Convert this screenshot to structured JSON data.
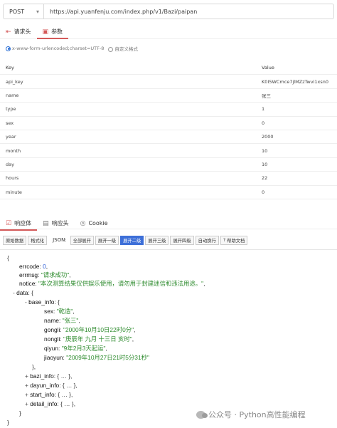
{
  "request": {
    "method": "POST",
    "url": "https://api.yuanfenju.com/index.php/v1/Bazi/paipan"
  },
  "top_tabs": [
    {
      "label": "请求头",
      "icon": "headers-icon"
    },
    {
      "label": "参数",
      "icon": "params-icon"
    }
  ],
  "body_type": {
    "option1": "x-www-form-urlencoded;charset=UTF-8",
    "option2": "自定义格式"
  },
  "params": {
    "key_header": "Key",
    "value_header": "Value",
    "rows": [
      {
        "key": "api_key",
        "value": "K0I5WCmce7jlMZzTwvi1xsn0"
      },
      {
        "key": "name",
        "value": "张三"
      },
      {
        "key": "type",
        "value": "1"
      },
      {
        "key": "sex",
        "value": "0"
      },
      {
        "key": "year",
        "value": "2000"
      },
      {
        "key": "month",
        "value": "10"
      },
      {
        "key": "day",
        "value": "10"
      },
      {
        "key": "hours",
        "value": "22"
      },
      {
        "key": "minute",
        "value": "0"
      }
    ]
  },
  "response_tabs": [
    {
      "label": "响应体",
      "icon": "response-body-icon"
    },
    {
      "label": "响应头",
      "icon": "response-headers-icon"
    },
    {
      "label": "Cookie",
      "icon": "cookie-icon"
    }
  ],
  "toolbar": {
    "raw": "原始数据",
    "format": "格式化",
    "json_label": "JSON:",
    "expand_all": "全部展开",
    "expand_1": "展开一级",
    "expand_2": "展开二级",
    "expand_3": "展开三级",
    "expand_4": "展开四级",
    "auto_wrap": "自动换行",
    "help": "帮助文档"
  },
  "json": {
    "open_brace": "{",
    "errcode_key": "errcode",
    "errcode_val": "0",
    "errmsg_key": "errmsg",
    "errmsg_val": "\"请求成功\"",
    "notice_key": "notice",
    "notice_val": "\"本次测算结果仅供娱乐使用，请勿用于封建迷信和违法用途。\"",
    "data_key": "data",
    "base_info_key": "base_info",
    "sex_key": "sex",
    "sex_val": "\"乾造\"",
    "name_key": "name",
    "name_val": "\"张三\"",
    "gongli_key": "gongli",
    "gongli_val": "\"2000年10月10日22时0分\"",
    "nongli_key": "nongli",
    "nongli_val": "\"庚辰年 九月 十三日 亥时\"",
    "qiyun_key": "qiyun",
    "qiyun_val": "\"9年2月3天起运\"",
    "jiaoyun_key": "jiaoyun",
    "jiaoyun_val": "\"2009年10月27日21时5分31秒\"",
    "bazi_info_key": "bazi_info",
    "dayun_info_key": "dayun_info",
    "start_info_key": "start_info",
    "detail_info_key": "detail_info",
    "collapsed": "{ … }",
    "close_brace": "}"
  },
  "watermark": "公众号 · Python高性能编程"
}
